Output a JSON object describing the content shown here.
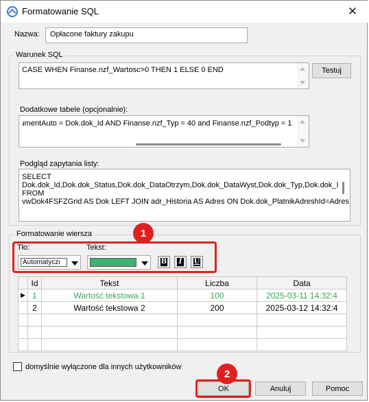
{
  "window": {
    "title": "Formatowanie SQL"
  },
  "name_field": {
    "label": "Nazwa:",
    "value": "Opłacone faktury zakupu"
  },
  "sql_condition": {
    "group_label": "Warunek SQL",
    "value": "CASE WHEN Finanse.nzf_Wartosc>0 THEN 1 ELSE 0 END",
    "test_button": "Testuj"
  },
  "extra_tables": {
    "label": "Dodatkowe tabele (opcjonalnie):",
    "value": "ɹmentAuto = Dok.dok_Id AND Finanse.nzf_Typ = 40 and Finanse.nzf_Podtyp = 1"
  },
  "query_preview": {
    "label": "Podgląd zapytania listy:",
    "lines": [
      "SELECT",
      "Dok.dok_Id,Dok.dok_Status,Dok.dok_DataOtrzym,Dok.dok_DataWyst,Dok.dok_Typ,Dok.dok_I",
      "FROM",
      "vwDok4FSFZGrid AS Dok LEFT JOIN adr_Historia AS Adres ON Dok.dok_PlatnikAdreshId=Adres"
    ]
  },
  "row_formatting": {
    "group_label": "Formatowanie wiersza",
    "background": {
      "label": "Tło:",
      "value": "Automatyczı"
    },
    "text": {
      "label": "Tekst:",
      "color": "#3cb371"
    },
    "bold_icon": "bold-icon",
    "italic_icon": "italic-icon",
    "underline_icon": "underline-icon"
  },
  "grid": {
    "columns": [
      "Id",
      "Tekst",
      "Liczba",
      "Data"
    ],
    "rows": [
      {
        "id": "1",
        "text": "Wartość tekstowa 1",
        "number": "100",
        "date": "2025-03-11 14:32:4",
        "highlight_color": "#3aa15a",
        "current": true
      },
      {
        "id": "2",
        "text": "Wartość tekstowa 2",
        "number": "200",
        "date": "2025-03-12 14:32:4",
        "current": false
      }
    ]
  },
  "disabled_checkbox": {
    "label": "domyślnie wyłączone dla innych użytkowników",
    "checked": false
  },
  "buttons": {
    "ok": "OK",
    "cancel": "Anuluj",
    "help": "Pomoc"
  },
  "annotations": {
    "badge1": "1",
    "badge2": "2",
    "color": "#e02020"
  }
}
